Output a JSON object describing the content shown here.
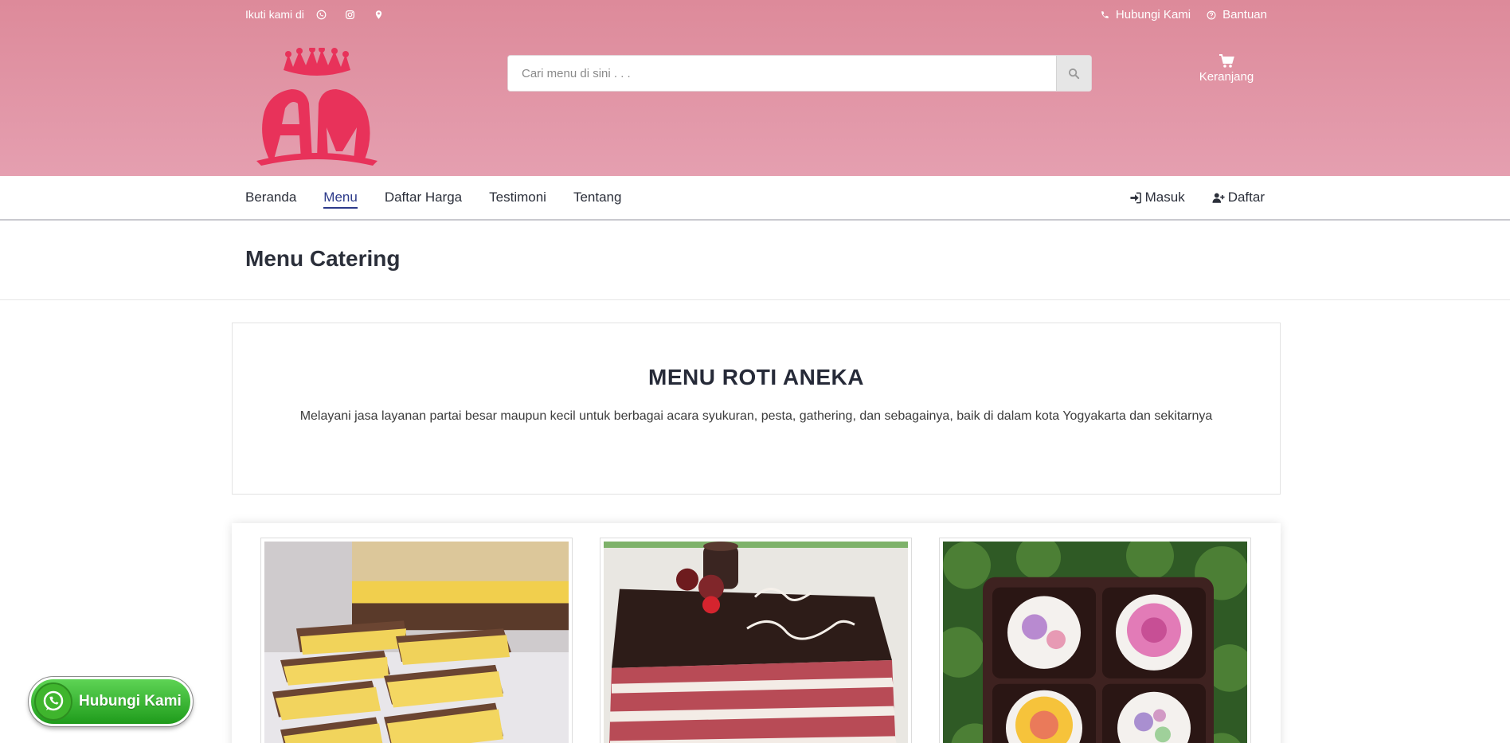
{
  "topbar": {
    "follow_label": "Ikuti kami di",
    "social_icons": [
      "whatsapp-icon",
      "instagram-icon",
      "map-marker-icon"
    ],
    "contact_label": "Hubungi Kami",
    "help_label": "Bantuan"
  },
  "search": {
    "placeholder": "Cari menu di sini . . ."
  },
  "cart": {
    "label": "Keranjang"
  },
  "nav": {
    "items": [
      "Beranda",
      "Menu",
      "Daftar Harga",
      "Testimoni",
      "Tentang"
    ],
    "active": "Menu",
    "login_label": "Masuk",
    "register_label": "Daftar"
  },
  "page": {
    "title": "Menu Catering"
  },
  "intro": {
    "heading": "MENU ROTI ANEKA",
    "description": "Melayani jasa layanan partai besar maupun kecil untuk berbagai acara syukuran, pesta, gathering, dan sebagainya, baik di dalam kota Yogyakarta dan sekitarnya"
  },
  "floating": {
    "whatsapp_label": "Hubungi Kami"
  },
  "colors": {
    "header_top": "#dd8a9a",
    "header_bottom": "#e59fb0",
    "logo": "#e8325a",
    "nav_active": "#2c3a8a",
    "whatsapp": "#2bb52b"
  }
}
